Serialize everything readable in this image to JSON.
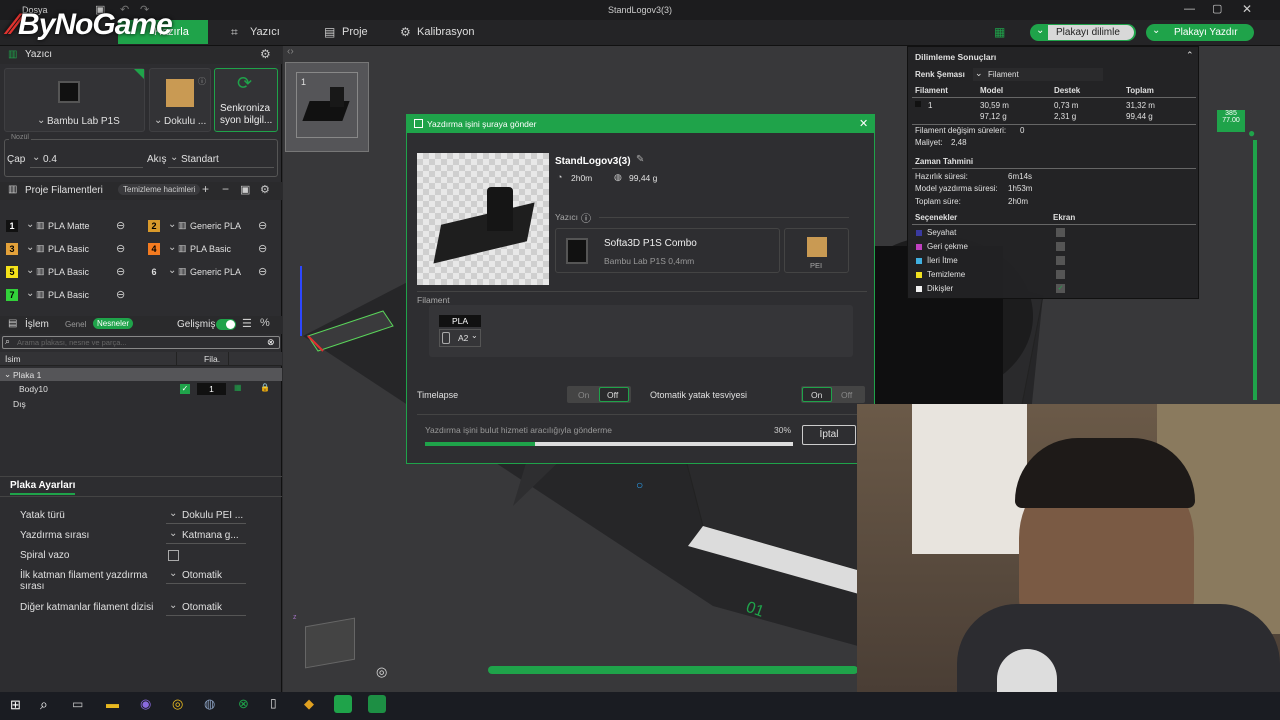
{
  "window": {
    "title": "StandLogov3(3)",
    "menu_left": "Dosya"
  },
  "watermark": "ByNoGame",
  "nav": {
    "home": "Hazırla",
    "printer": "Yazıcı",
    "project": "Proje",
    "calibration": "Kalibrasyon"
  },
  "actions": {
    "slice": "Plakayı dilimle",
    "print": "Plakayı Yazdır"
  },
  "printer_section": {
    "title": "Yazıcı",
    "printer_name": "Bambu Lab P1S",
    "plate": "Dokulu ...",
    "sync": "Senkronize et",
    "sync_line1": "Senkroniza",
    "sync_line2": "syon bilgil...",
    "nozzle_label": "Çap",
    "nozzle_value": "0.4",
    "flow_label": "Akış",
    "flow_value": "Standart",
    "nozzle_tag": "Nozül"
  },
  "filaments": {
    "title": "Proje Filamentleri",
    "flush_btn": "Temizleme hacimleri",
    "items": [
      {
        "num": "1",
        "name": "PLA Matte",
        "color": "#111111",
        "numcolor": "#ffffff"
      },
      {
        "num": "2",
        "name": "Generic PLA",
        "color": "#d99a2b",
        "numcolor": "#000000"
      },
      {
        "num": "3",
        "name": "PLA Basic",
        "color": "#e3a13a",
        "numcolor": "#000000"
      },
      {
        "num": "4",
        "name": "PLA Basic",
        "color": "#f47b20",
        "numcolor": "#000000"
      },
      {
        "num": "5",
        "name": "PLA Basic",
        "color": "#f5e21a",
        "numcolor": "#000000"
      },
      {
        "num": "6",
        "name": "Generic PLA",
        "color": "#2d2d30",
        "numcolor": "#dddddd"
      },
      {
        "num": "7",
        "name": "PLA Basic",
        "color": "#32d13a",
        "numcolor": "#000000"
      }
    ]
  },
  "process": {
    "title": "İşlem",
    "tab_global": "Genel",
    "tab_objects": "Nesneler",
    "advanced": "Gelişmiş",
    "search_placeholder": "Arama plakası, nesne ve parça...",
    "col_name": "İsim",
    "col_fila": "Fila.",
    "plate": "Plaka 1",
    "body": "Body10",
    "body_fila": "1",
    "outside": "Dış"
  },
  "plate_settings": {
    "title": "Plaka Ayarları",
    "rows": [
      {
        "label": "Yatak türü",
        "value": "Dokulu PEI ..."
      },
      {
        "label": "Yazdırma sırası",
        "value": "Katmana g..."
      },
      {
        "label": "Spiral vazo",
        "value": ""
      },
      {
        "label": "İlk katman filament yazdırma sırası",
        "value": "Otomatik"
      },
      {
        "label": "Diğer katmanlar filament dizisi",
        "value": "Otomatik"
      }
    ]
  },
  "thumb": {
    "label": "1"
  },
  "dialog": {
    "title": "Yazdırma işini şuraya gönder",
    "model_name": "StandLogov3(3)",
    "time": "2h0m",
    "weight": "99,44 g",
    "printer_label": "Yazıcı",
    "printer_name": "Softa3D P1S Combo",
    "printer_sub": "Bambu Lab P1S  0,4mm",
    "plate_tag": "PEI",
    "filament_label": "Filament",
    "fil_type": "PLA",
    "fil_slot": "A2",
    "timelapse": "Timelapse",
    "on": "On",
    "off": "Off",
    "auto_level": "Otomatik yatak tesviyesi",
    "progress_text": "Yazdırma işini bulut hizmeti aracılığıyla gönderme",
    "progress_pct": "30%",
    "progress": 0.3,
    "cancel": "İptal"
  },
  "slice_result": {
    "title": "Dilimleme Sonuçları",
    "color_scheme": "Renk Şeması",
    "scheme_value": "Filament",
    "headers": [
      "Filament",
      "Model",
      "Destek",
      "Toplam"
    ],
    "row": {
      "id": "1",
      "model_m": "30,59 m",
      "model_g": "97,12 g",
      "support_m": "0,73 m",
      "support_g": "2,31 g",
      "total_m": "31,32 m",
      "total_g": "99,44 g"
    },
    "change_time": "Filament değişim süreleri:",
    "change_val": "0",
    "cost": "Maliyet:",
    "cost_val": "2,48",
    "time_title": "Zaman Tahmini",
    "prep": "Hazırlık süresi:",
    "prep_val": "6m14s",
    "model_time": "Model yazdırma süresi:",
    "model_time_val": "1h53m",
    "total_time": "Toplam süre:",
    "total_time_val": "2h0m",
    "options_title": "Seçenekler",
    "display_title": "Ekran",
    "options": [
      {
        "name": "Seyahat",
        "color": "#3a3aa0"
      },
      {
        "name": "Geri çekme",
        "color": "#c040c0"
      },
      {
        "name": "İleri İtme",
        "color": "#40b0e0"
      },
      {
        "name": "Temizleme",
        "color": "#f0e020"
      },
      {
        "name": "Dikişler",
        "color": "#f0f0f0"
      }
    ]
  },
  "slider": {
    "top": "385",
    "top2": "77.00"
  }
}
